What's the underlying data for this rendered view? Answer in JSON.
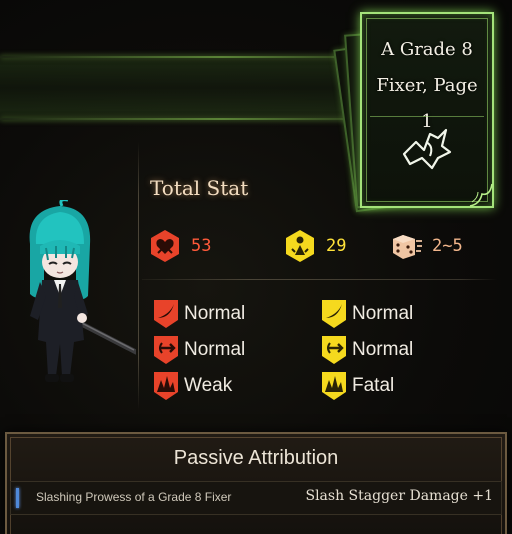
{
  "page": {
    "title_line1": "A Grade 8",
    "title_line2": "Fixer, Page 1",
    "art_icon": "fixer-emblem-icon"
  },
  "stats": {
    "title": "Total Stat",
    "hp": {
      "icon": "hp-heart-icon",
      "value": "53",
      "color": "#ff5a3a"
    },
    "stagger": {
      "icon": "stagger-icon",
      "value": "29",
      "color": "#ffe23a"
    },
    "speed": {
      "icon": "speed-dice-icon",
      "value": "2~5",
      "color": "#f2b68c"
    }
  },
  "resistances": {
    "hp": [
      {
        "type": "slash",
        "icon": "slash-resist-icon",
        "label": "Normal"
      },
      {
        "type": "pierce",
        "icon": "pierce-resist-icon",
        "label": "Normal"
      },
      {
        "type": "blunt",
        "icon": "blunt-resist-icon",
        "label": "Weak"
      }
    ],
    "stagger": [
      {
        "type": "slash",
        "icon": "slash-stagger-resist-icon",
        "label": "Normal"
      },
      {
        "type": "pierce",
        "icon": "pierce-stagger-resist-icon",
        "label": "Normal"
      },
      {
        "type": "blunt",
        "icon": "blunt-stagger-resist-icon",
        "label": "Fatal"
      }
    ]
  },
  "passive": {
    "title": "Passive Attribution",
    "items": [
      {
        "name": "Slashing Prowess of a Grade 8 Fixer",
        "description": "Slash Stagger Damage +1"
      }
    ]
  },
  "colors": {
    "hp_red": "#e8432a",
    "stagger_yellow": "#f5d91e",
    "page_green": "#a4e37a",
    "panel_border": "#6c5a40"
  }
}
